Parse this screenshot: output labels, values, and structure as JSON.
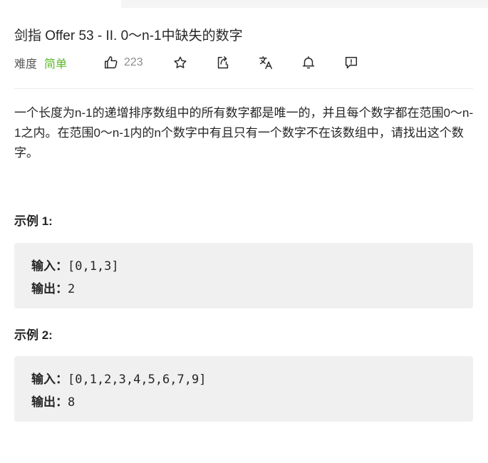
{
  "problem": {
    "title": "剑指 Offer 53 - II. 0～n-1中缺失的数字",
    "difficulty_label": "难度",
    "difficulty_value": "简单",
    "likes": "223",
    "difficulty_color": "#5ab726"
  },
  "actions": {
    "icons": [
      "thumbs-up-icon",
      "star-icon",
      "share-icon",
      "translate-icon",
      "bell-icon",
      "feedback-icon"
    ]
  },
  "description": "一个长度为n-1的递增排序数组中的所有数字都是唯一的，并且每个数字都在范围0～n-1之内。在范围0～n-1内的n个数字中有且只有一个数字不在该数组中，请找出这个数字。",
  "examples": [
    {
      "title": "示例 1:",
      "input_label": "输入：",
      "input": "[0,1,3]",
      "output_label": "输出：",
      "output": "2"
    },
    {
      "title": "示例 2:",
      "input_label": "输入：",
      "input": "[0,1,2,3,4,5,6,7,9]",
      "output_label": "输出：",
      "output": "8"
    }
  ]
}
